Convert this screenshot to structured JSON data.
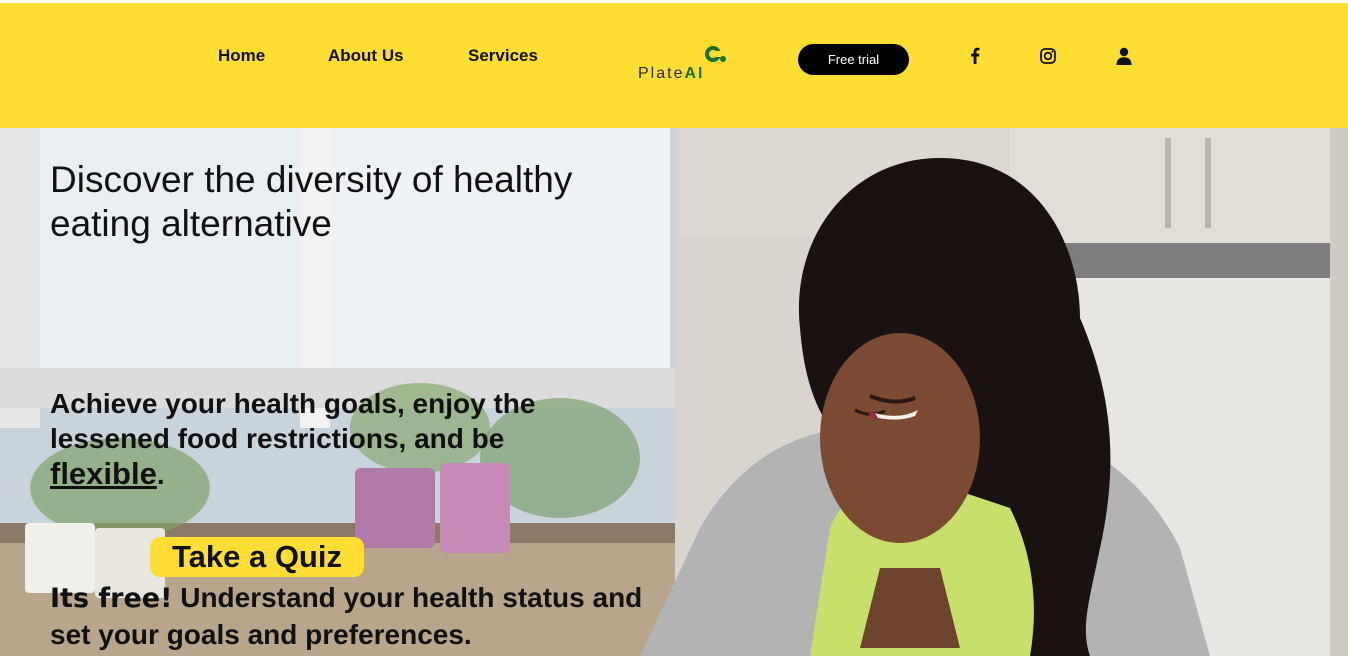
{
  "nav": {
    "home": "Home",
    "about": "About Us",
    "services": "Services"
  },
  "logo": {
    "text_plain": "Plate",
    "text_bold": "AI"
  },
  "cta": {
    "free_trial": "Free trial"
  },
  "social": {
    "icons": [
      "facebook-icon",
      "instagram-icon",
      "user-icon"
    ]
  },
  "hero": {
    "title": "Discover the diversity of healthy eating alternative",
    "subtitle_main": "Achieve your health goals, enjoy the lessened food restrictions, and be",
    "subtitle_emphasis": "flexible",
    "subtitle_end": ".",
    "quiz_button": "Take a Quiz",
    "free_label": "Its free!",
    "free_text": " Understand your health status and set your goals and preferences."
  },
  "colors": {
    "brand_yellow": "#ffde33",
    "logo_green": "#1e6f2a",
    "button_black": "#000000"
  }
}
